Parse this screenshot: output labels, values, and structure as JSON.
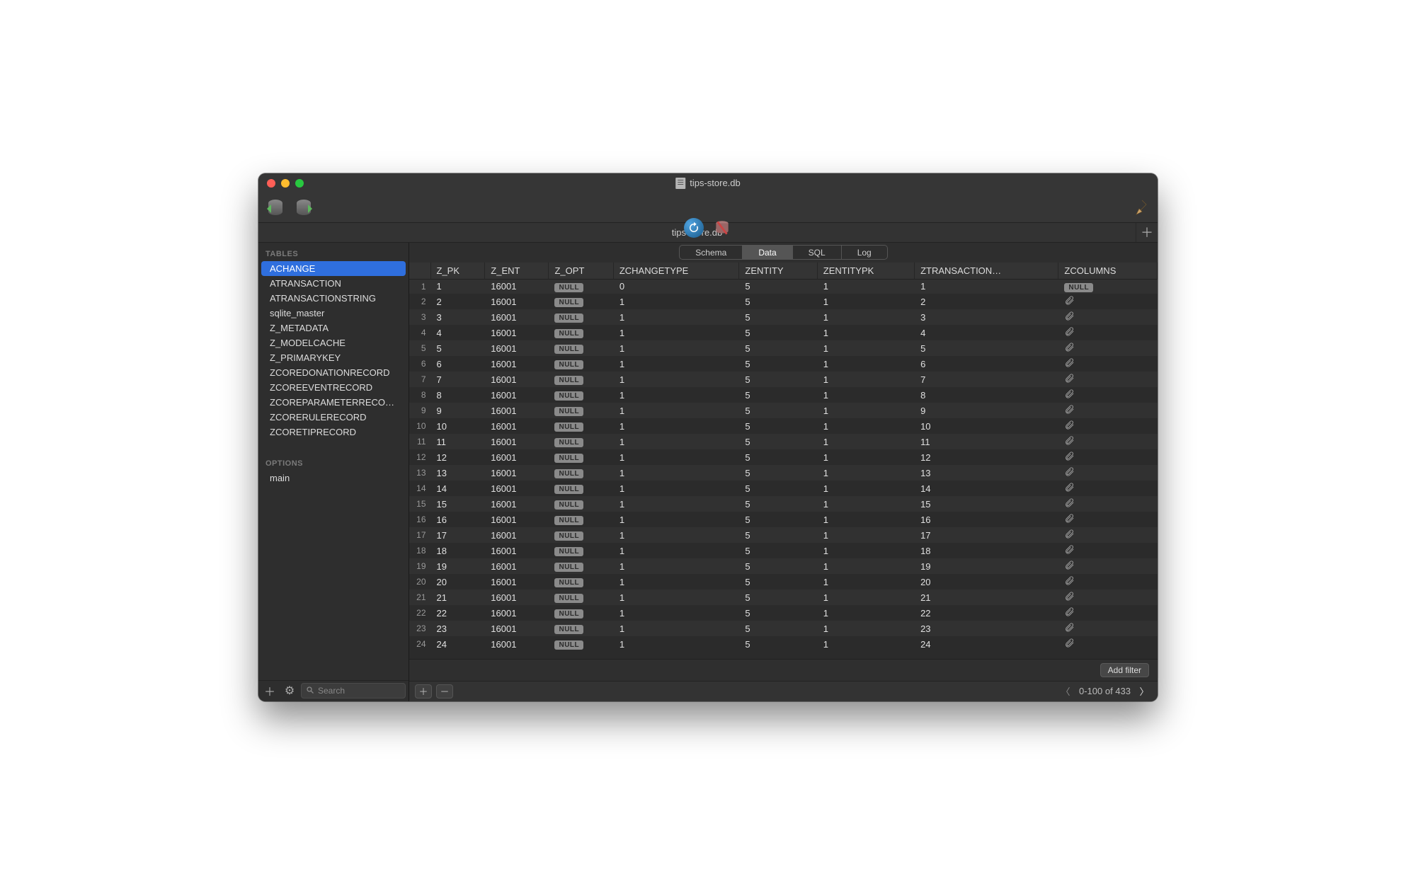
{
  "window_title": "tips-store.db",
  "tab_title": "tips-store.db",
  "sidebar": {
    "section_tables_label": "TABLES",
    "section_options_label": "OPTIONS",
    "tables": [
      "ACHANGE",
      "ATRANSACTION",
      "ATRANSACTIONSTRING",
      "sqlite_master",
      "Z_METADATA",
      "Z_MODELCACHE",
      "Z_PRIMARYKEY",
      "ZCOREDONATIONRECORD",
      "ZCOREEVENTRECORD",
      "ZCOREPARAMETERRECORD",
      "ZCORERULERECORD",
      "ZCORETIPRECORD"
    ],
    "selected_table": "ACHANGE",
    "options": [
      "main"
    ],
    "search_placeholder": "Search"
  },
  "view_tabs": {
    "items": [
      "Schema",
      "Data",
      "SQL",
      "Log"
    ],
    "active": "Data"
  },
  "columns": [
    "Z_PK",
    "Z_ENT",
    "Z_OPT",
    "ZCHANGETYPE",
    "ZENTITY",
    "ZENTITYPK",
    "ZTRANSACTION…",
    "ZCOLUMNS"
  ],
  "rows": [
    {
      "n": 1,
      "z_pk": "1",
      "z_ent": "16001",
      "z_opt": null,
      "zchangetype": "0",
      "zentity": "5",
      "zentitypk": "1",
      "ztransaction": "1",
      "zcolumns": null
    },
    {
      "n": 2,
      "z_pk": "2",
      "z_ent": "16001",
      "z_opt": null,
      "zchangetype": "1",
      "zentity": "5",
      "zentitypk": "1",
      "ztransaction": "2",
      "zcolumns": "blob"
    },
    {
      "n": 3,
      "z_pk": "3",
      "z_ent": "16001",
      "z_opt": null,
      "zchangetype": "1",
      "zentity": "5",
      "zentitypk": "1",
      "ztransaction": "3",
      "zcolumns": "blob"
    },
    {
      "n": 4,
      "z_pk": "4",
      "z_ent": "16001",
      "z_opt": null,
      "zchangetype": "1",
      "zentity": "5",
      "zentitypk": "1",
      "ztransaction": "4",
      "zcolumns": "blob"
    },
    {
      "n": 5,
      "z_pk": "5",
      "z_ent": "16001",
      "z_opt": null,
      "zchangetype": "1",
      "zentity": "5",
      "zentitypk": "1",
      "ztransaction": "5",
      "zcolumns": "blob"
    },
    {
      "n": 6,
      "z_pk": "6",
      "z_ent": "16001",
      "z_opt": null,
      "zchangetype": "1",
      "zentity": "5",
      "zentitypk": "1",
      "ztransaction": "6",
      "zcolumns": "blob"
    },
    {
      "n": 7,
      "z_pk": "7",
      "z_ent": "16001",
      "z_opt": null,
      "zchangetype": "1",
      "zentity": "5",
      "zentitypk": "1",
      "ztransaction": "7",
      "zcolumns": "blob"
    },
    {
      "n": 8,
      "z_pk": "8",
      "z_ent": "16001",
      "z_opt": null,
      "zchangetype": "1",
      "zentity": "5",
      "zentitypk": "1",
      "ztransaction": "8",
      "zcolumns": "blob"
    },
    {
      "n": 9,
      "z_pk": "9",
      "z_ent": "16001",
      "z_opt": null,
      "zchangetype": "1",
      "zentity": "5",
      "zentitypk": "1",
      "ztransaction": "9",
      "zcolumns": "blob"
    },
    {
      "n": 10,
      "z_pk": "10",
      "z_ent": "16001",
      "z_opt": null,
      "zchangetype": "1",
      "zentity": "5",
      "zentitypk": "1",
      "ztransaction": "10",
      "zcolumns": "blob"
    },
    {
      "n": 11,
      "z_pk": "11",
      "z_ent": "16001",
      "z_opt": null,
      "zchangetype": "1",
      "zentity": "5",
      "zentitypk": "1",
      "ztransaction": "11",
      "zcolumns": "blob"
    },
    {
      "n": 12,
      "z_pk": "12",
      "z_ent": "16001",
      "z_opt": null,
      "zchangetype": "1",
      "zentity": "5",
      "zentitypk": "1",
      "ztransaction": "12",
      "zcolumns": "blob"
    },
    {
      "n": 13,
      "z_pk": "13",
      "z_ent": "16001",
      "z_opt": null,
      "zchangetype": "1",
      "zentity": "5",
      "zentitypk": "1",
      "ztransaction": "13",
      "zcolumns": "blob"
    },
    {
      "n": 14,
      "z_pk": "14",
      "z_ent": "16001",
      "z_opt": null,
      "zchangetype": "1",
      "zentity": "5",
      "zentitypk": "1",
      "ztransaction": "14",
      "zcolumns": "blob"
    },
    {
      "n": 15,
      "z_pk": "15",
      "z_ent": "16001",
      "z_opt": null,
      "zchangetype": "1",
      "zentity": "5",
      "zentitypk": "1",
      "ztransaction": "15",
      "zcolumns": "blob"
    },
    {
      "n": 16,
      "z_pk": "16",
      "z_ent": "16001",
      "z_opt": null,
      "zchangetype": "1",
      "zentity": "5",
      "zentitypk": "1",
      "ztransaction": "16",
      "zcolumns": "blob"
    },
    {
      "n": 17,
      "z_pk": "17",
      "z_ent": "16001",
      "z_opt": null,
      "zchangetype": "1",
      "zentity": "5",
      "zentitypk": "1",
      "ztransaction": "17",
      "zcolumns": "blob"
    },
    {
      "n": 18,
      "z_pk": "18",
      "z_ent": "16001",
      "z_opt": null,
      "zchangetype": "1",
      "zentity": "5",
      "zentitypk": "1",
      "ztransaction": "18",
      "zcolumns": "blob"
    },
    {
      "n": 19,
      "z_pk": "19",
      "z_ent": "16001",
      "z_opt": null,
      "zchangetype": "1",
      "zentity": "5",
      "zentitypk": "1",
      "ztransaction": "19",
      "zcolumns": "blob"
    },
    {
      "n": 20,
      "z_pk": "20",
      "z_ent": "16001",
      "z_opt": null,
      "zchangetype": "1",
      "zentity": "5",
      "zentitypk": "1",
      "ztransaction": "20",
      "zcolumns": "blob"
    },
    {
      "n": 21,
      "z_pk": "21",
      "z_ent": "16001",
      "z_opt": null,
      "zchangetype": "1",
      "zentity": "5",
      "zentitypk": "1",
      "ztransaction": "21",
      "zcolumns": "blob"
    },
    {
      "n": 22,
      "z_pk": "22",
      "z_ent": "16001",
      "z_opt": null,
      "zchangetype": "1",
      "zentity": "5",
      "zentitypk": "1",
      "ztransaction": "22",
      "zcolumns": "blob"
    },
    {
      "n": 23,
      "z_pk": "23",
      "z_ent": "16001",
      "z_opt": null,
      "zchangetype": "1",
      "zentity": "5",
      "zentitypk": "1",
      "ztransaction": "23",
      "zcolumns": "blob"
    },
    {
      "n": 24,
      "z_pk": "24",
      "z_ent": "16001",
      "z_opt": null,
      "zchangetype": "1",
      "zentity": "5",
      "zentitypk": "1",
      "ztransaction": "24",
      "zcolumns": "blob"
    }
  ],
  "null_label": "NULL",
  "filter": {
    "add_label": "Add filter"
  },
  "status": {
    "range_label": "0-100 of 433"
  }
}
